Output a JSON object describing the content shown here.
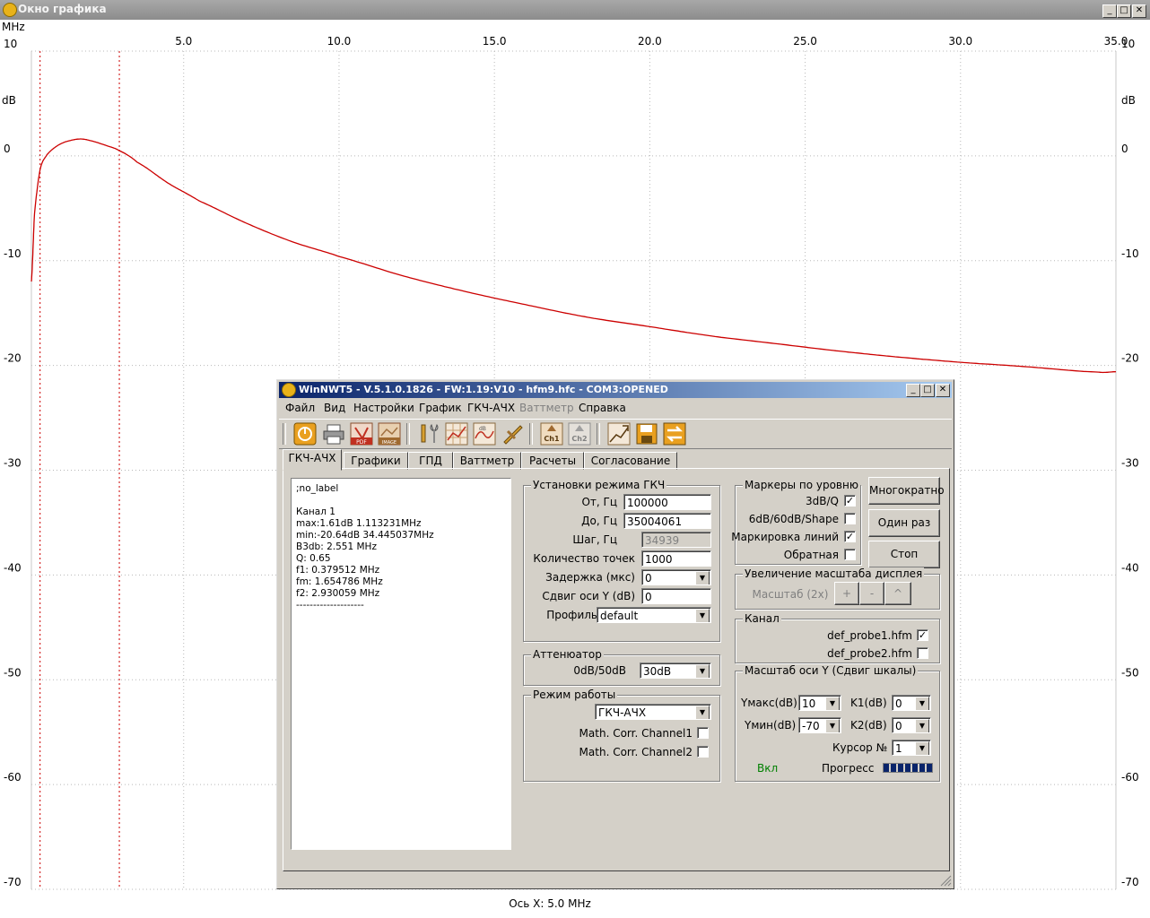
{
  "graph_window": {
    "title": "Окно графика",
    "x_unit": "MHz",
    "y_unit": "dB",
    "x_axis_caption": "Ось X: 5.0 MHz"
  },
  "chart_data": {
    "type": "line",
    "xlabel": "MHz",
    "ylabel": "dB",
    "xlim": [
      0.1,
      35.0
    ],
    "ylim": [
      -70,
      10
    ],
    "x_ticks": [
      "5.0",
      "10.0",
      "15.0",
      "20.0",
      "25.0",
      "30.0",
      "35.0"
    ],
    "y_ticks": [
      "10",
      "0",
      "-10",
      "-20",
      "-30",
      "-40",
      "-50",
      "-60",
      "-70"
    ],
    "grid": true,
    "series": [
      {
        "color": "#cc0000",
        "x": [
          0.1,
          0.2,
          0.38,
          0.6,
          0.9,
          1.2,
          1.65,
          2.0,
          2.5,
          2.93,
          3.5,
          4.5,
          5.5,
          7.0,
          8.5,
          10.0,
          12.0,
          14.0,
          16.0,
          18.0,
          20.0,
          22.0,
          24.0,
          26.0,
          28.0,
          30.0,
          32.0,
          34.445,
          35.0
        ],
        "y": [
          -12.0,
          -5.5,
          -1.3,
          0.1,
          0.9,
          1.35,
          1.61,
          1.45,
          1.0,
          0.5,
          -0.6,
          -2.6,
          -4.3,
          -6.4,
          -8.2,
          -9.6,
          -11.4,
          -12.9,
          -14.2,
          -15.4,
          -16.3,
          -17.2,
          -17.9,
          -18.6,
          -19.2,
          -19.7,
          -20.1,
          -20.64,
          -20.6
        ]
      }
    ],
    "markers_x": [
      0.379512,
      2.930059
    ]
  },
  "app": {
    "title": "WinNWT5 - V.5.1.0.1826 - FW:1.19:V10 - hfm9.hfc - COM3:OPENED",
    "menu": [
      "Файл",
      "Вид",
      "Настройки",
      "График",
      "ГКЧ-АЧХ",
      "Ваттметр",
      "Справка"
    ],
    "toolbar_icons": [
      "power-icon",
      "printer-icon",
      "pdf-icon",
      "image-icon",
      "tools-icon",
      "chart-grid-icon",
      "db-chart-icon",
      "probe-icon",
      "ch1-icon",
      "ch2-icon",
      "chart-export-icon",
      "save-icon",
      "swap-icon"
    ],
    "toolbar_text": {
      "pdf": "PDF",
      "image": "IMAGE",
      "ch1": "Ch1",
      "ch2": "Ch2"
    },
    "tabs": [
      "ГКЧ-АЧХ",
      "Графики",
      "ГПД",
      "Ваттметр",
      "Расчеты",
      "Согласование"
    ],
    "info_lines": [
      ";no_label",
      "",
      "Канал 1",
      "max:1.61dB 1.113231MHz",
      "min:-20.64dB 34.445037MHz",
      "B3db: 2.551 MHz",
      "Q: 0.65",
      "f1: 0.379512 MHz",
      "fm: 1.654786 MHz",
      "f2: 2.930059 MHz",
      "--------------------"
    ],
    "sweep": {
      "group": "Установки режима ГКЧ",
      "from_label": "От, Гц",
      "from_value": "100000",
      "to_label": "До, Гц",
      "to_value": "35004061",
      "step_label": "Шаг, Гц",
      "step_value": "34939",
      "points_label": "Количество точек",
      "points_value": "1000",
      "delay_label": "Задержка (мкс)",
      "delay_value": "0",
      "yshift_label": "Сдвиг оси Y (dB)",
      "yshift_value": "0",
      "profile_label": "Профиль",
      "profile_value": "default"
    },
    "attenuator": {
      "group": "Аттенюатор",
      "label": "0dB/50dB",
      "value": "30dB"
    },
    "mode": {
      "group": "Режим работы",
      "value": "ГКЧ-АЧХ",
      "corr1": "Math. Corr. Channel1",
      "corr2": "Math. Corr. Channel2"
    },
    "markers": {
      "group": "Маркеры по уровню",
      "m3db": "3dB/Q",
      "m6db": "6dB/60dB/Shape",
      "lines": "Маркировка линий",
      "reverse": "Обратная"
    },
    "buttons": {
      "multi": "Многократно",
      "once": "Один раз",
      "stop": "Стоп"
    },
    "zoom": {
      "group": "Увеличение масштаба дисплея",
      "scale": "Масштаб (2x)",
      "plus": "+",
      "minus": "-",
      "up": "^"
    },
    "channel": {
      "group": "Канал",
      "probe1": "def_probe1.hfm",
      "probe2": "def_probe2.hfm"
    },
    "yscale": {
      "group": "Масштаб оси Y (Сдвиг шкалы)",
      "ymax_label": "Yмакс(dB)",
      "ymax_value": "10",
      "ymin_label": "Yмин(dB)",
      "ymin_value": "-70",
      "k1_label": "K1(dB)",
      "k1_value": "0",
      "k2_label": "K2(dB)",
      "k2_value": "0",
      "cursor_label": "Курсор №",
      "cursor_value": "1",
      "on_label": "Вкл",
      "progress_label": "Прогресс"
    },
    "colors": {
      "on_green": "#008000",
      "progress": "#0a246a",
      "trace": "#cc0000"
    }
  }
}
